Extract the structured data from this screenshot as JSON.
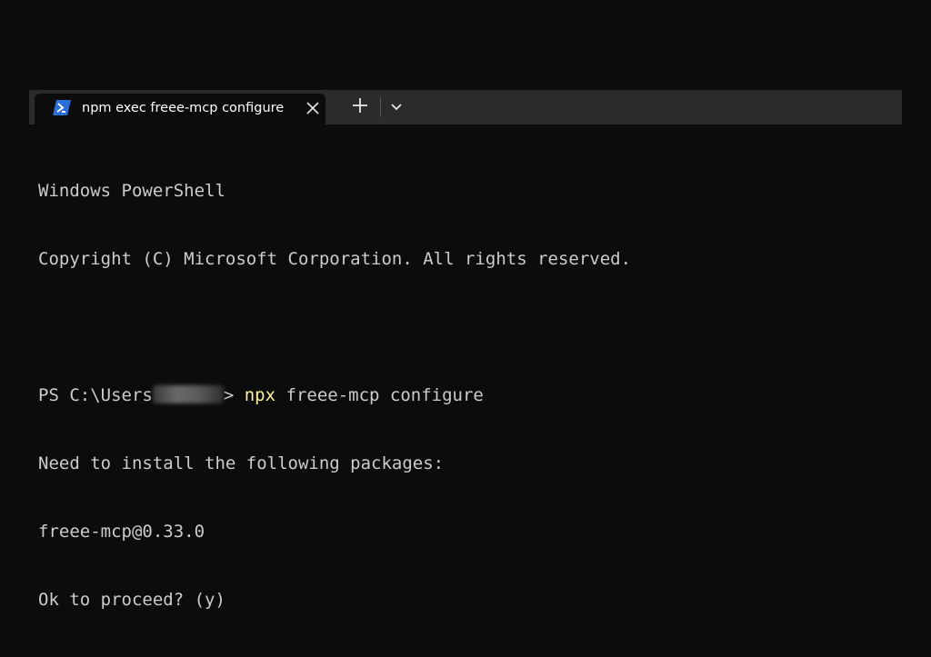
{
  "tab": {
    "title": "npm exec freee-mcp configure",
    "icon": "powershell-icon"
  },
  "tabbar": {
    "new_tab_icon": "plus-icon",
    "dropdown_icon": "chevron-down-icon",
    "close_icon": "close-icon"
  },
  "terminal": {
    "header_line1": "Windows PowerShell",
    "header_line2": "Copyright (C) Microsoft Corporation. All rights reserved.",
    "prompt_prefix": "PS C:\\Users",
    "prompt_suffix": "> ",
    "command_exe": "npx",
    "command_args": " freee-mcp configure",
    "output_line1": "Need to install the following packages:",
    "output_line2": "freee-mcp@0.33.0",
    "output_line3": "Ok to proceed? (y)"
  },
  "colors": {
    "background": "#0c0c0c",
    "tabbar": "#2b2b2b",
    "text": "#cccccc",
    "command_highlight": "#f9f1a5",
    "powershell_blue": "#2b6fd6"
  }
}
